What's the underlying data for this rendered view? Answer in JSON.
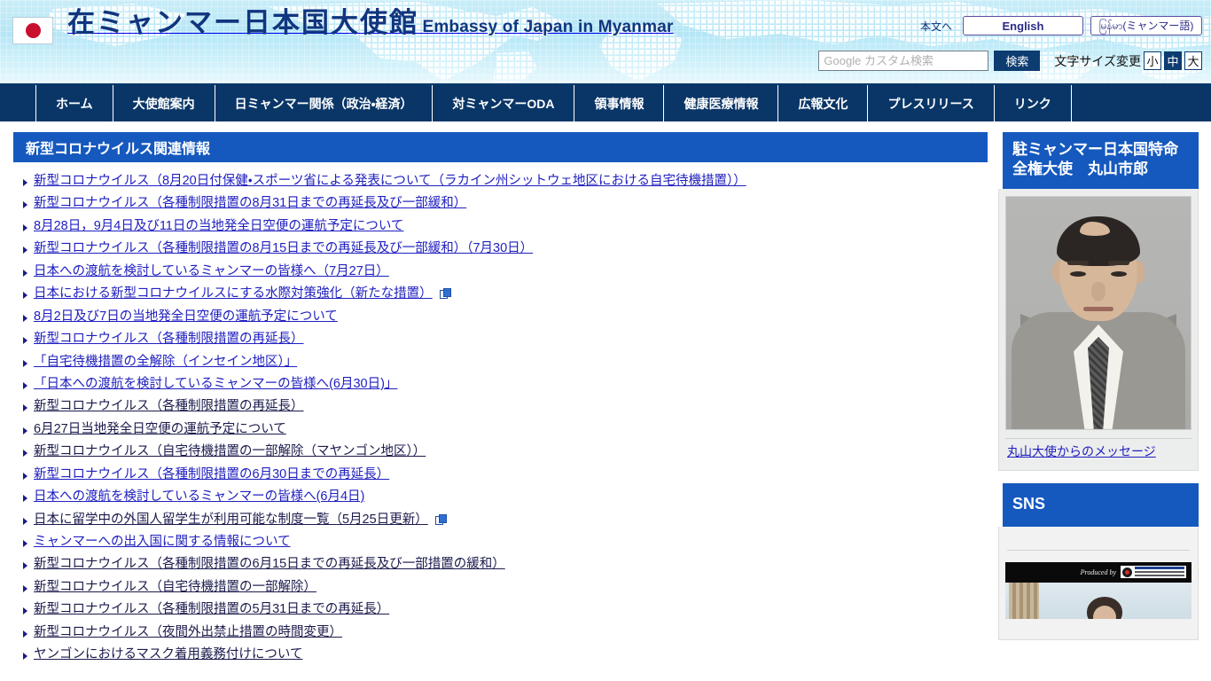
{
  "header": {
    "flag_icon": "japan-flag-icon",
    "title_jp": "在ミャンマー日本国大使館",
    "title_en": "Embassy of Japan in Myanmar",
    "skip_link": "本文へ",
    "lang_english": "English",
    "lang_myanmar": "မြန်မာ(ミャンマー語)",
    "search": {
      "placeholder": "Google カスタム検索",
      "value": "",
      "button": "検索"
    },
    "fontsize": {
      "label": "文字サイズ変更",
      "options": [
        "小",
        "中",
        "大"
      ],
      "selected": "中"
    }
  },
  "nav": {
    "items": [
      {
        "label": "ホーム"
      },
      {
        "label": "大使館案内"
      },
      {
        "label": "日ミャンマー関係（政治・経済）"
      },
      {
        "label": "対ミャンマーODA"
      },
      {
        "label": "領事情報"
      },
      {
        "label": "健康医療情報"
      },
      {
        "label": "広報文化"
      },
      {
        "label": "プレスリリース"
      },
      {
        "label": "リンク"
      }
    ]
  },
  "main": {
    "section_title": "新型コロナウイルス関連情報",
    "links": [
      {
        "label": "新型コロナウイルス（8月20日付保健・スポーツ省による発表について（ラカイン州シットウェ地区における自宅待機措置））",
        "visited": false,
        "external": false
      },
      {
        "label": "新型コロナウイルス（各種制限措置の8月31日までの再延長及び一部緩和）",
        "visited": false,
        "external": false
      },
      {
        "label": "8月28日，9月4日及び11日の当地発全日空便の運航予定について",
        "visited": false,
        "external": false
      },
      {
        "label": "新型コロナウイルス（各種制限措置の8月15日までの再延長及び一部緩和）（7月30日）",
        "visited": false,
        "external": false
      },
      {
        "label": "日本への渡航を検討しているミャンマーの皆様へ（7月27日）",
        "visited": false,
        "external": false
      },
      {
        "label": "日本における新型コロナウイルスにする水際対策強化（新たな措置）",
        "visited": false,
        "external": true
      },
      {
        "label": "8月2日及び7日の当地発全日空便の運航予定について",
        "visited": false,
        "external": false
      },
      {
        "label": "新型コロナウイルス（各種制限措置の再延長）",
        "visited": false,
        "external": false
      },
      {
        "label": "「自宅待機措置の全解除（インセイン地区）」",
        "visited": false,
        "external": false
      },
      {
        "label": "「日本への渡航を検討しているミャンマーの皆様へ(6月30日)」",
        "visited": false,
        "external": false
      },
      {
        "label": "新型コロナウイルス（各種制限措置の再延長）",
        "visited": true,
        "external": false
      },
      {
        "label": "6月27日当地発全日空便の運航予定について",
        "visited": true,
        "external": false
      },
      {
        "label": "新型コロナウイルス（自宅待機措置の一部解除（マヤンゴン地区））",
        "visited": true,
        "external": false
      },
      {
        "label": "新型コロナウイルス（各種制限措置の6月30日までの再延長）",
        "visited": false,
        "external": false
      },
      {
        "label": "日本への渡航を検討しているミャンマーの皆様へ(6月4日)",
        "visited": false,
        "external": false
      },
      {
        "label": "日本に留学中の外国人留学生が利用可能な制度一覧（5月25日更新）",
        "visited": true,
        "external": true
      },
      {
        "label": "ミャンマーへの出入国に関する情報について",
        "visited": false,
        "external": false
      },
      {
        "label": "新型コロナウイルス（各種制限措置の6月15日までの再延長及び一部措置の緩和）",
        "visited": true,
        "external": false
      },
      {
        "label": "新型コロナウイルス（自宅待機措置の一部解除）",
        "visited": true,
        "external": false
      },
      {
        "label": "新型コロナウイルス（各種制限措置の5月31日までの再延長）",
        "visited": true,
        "external": false
      },
      {
        "label": "新型コロナウイルス（夜間外出禁止措置の時間変更）",
        "visited": true,
        "external": false
      },
      {
        "label": "ヤンゴンにおけるマスク着用義務付けについて",
        "visited": true,
        "external": false
      }
    ]
  },
  "sidebar": {
    "ambassador": {
      "title": "駐ミャンマー日本国特命全権大使　丸山市郎",
      "photo_alt": "ambassador-portrait",
      "message_link": "丸山大使からのメッセージ"
    },
    "sns": {
      "title": "SNS",
      "video_produced_by": "Produced by"
    }
  },
  "colors": {
    "nav_bg": "#0a3667",
    "section_bg": "#1559bf",
    "link": "#2020c0",
    "link_visited": "#1b1b4d",
    "header_gradient_top": "#c9edf8",
    "flag_red": "#c8102e"
  }
}
